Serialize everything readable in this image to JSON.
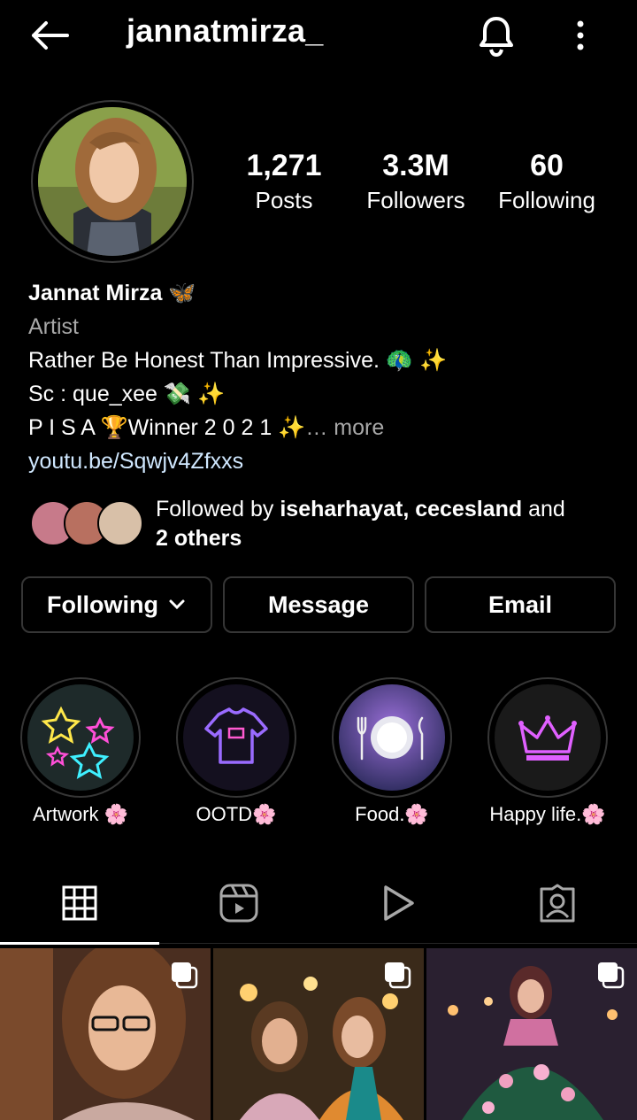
{
  "header": {
    "username": "jannatmirza_",
    "back_icon": "arrow-left-icon",
    "bell_icon": "bell-icon",
    "more_icon": "more-vertical-icon"
  },
  "stats": {
    "posts": {
      "value": "1,271",
      "label": "Posts"
    },
    "followers": {
      "value": "3.3M",
      "label": "Followers"
    },
    "following": {
      "value": "60",
      "label": "Following"
    }
  },
  "bio": {
    "name": "Jannat Mirza 🦋",
    "category": "Artist",
    "line1": "Rather Be Honest Than Impressive. 🦚 ✨",
    "line2": "Sc : que_xee 💸 ✨",
    "line3": "P I S A 🏆Winner 2 0 2 1 ✨",
    "more": "… more",
    "link": "youtu.be/Sqwjv4Zfxxs"
  },
  "followed_by": {
    "prefix": "Followed by ",
    "names": "iseharhayat, cecesland",
    "and": " and",
    "others": "2 others"
  },
  "buttons": {
    "following": "Following",
    "message": "Message",
    "email": "Email"
  },
  "highlights": [
    {
      "label": "Artwork 🌸"
    },
    {
      "label": "OOTD🌸"
    },
    {
      "label": "Food.🌸"
    },
    {
      "label": "Happy life.🌸"
    }
  ],
  "tabs": [
    "grid-icon",
    "reels-icon",
    "play-icon",
    "tagged-icon"
  ],
  "colors": {
    "background": "#000000",
    "border": "#363636",
    "muted": "#a8a8a8",
    "link": "#d0e8ff"
  }
}
